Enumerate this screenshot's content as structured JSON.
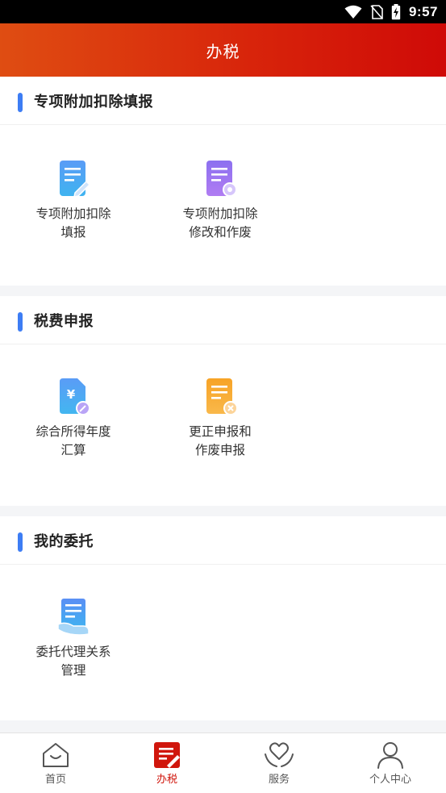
{
  "status_bar": {
    "time": "9:57"
  },
  "header": {
    "title": "办税"
  },
  "sections": [
    {
      "title": "专项附加扣除填报",
      "items": [
        {
          "line1": "专项附加扣除",
          "line2": "填报",
          "icon": "edit-document-icon"
        },
        {
          "line1": "专项附加扣除",
          "line2": "修改和作废",
          "icon": "document-settings-icon"
        }
      ]
    },
    {
      "title": "税费申报",
      "items": [
        {
          "line1": "综合所得年度",
          "line2": "汇算",
          "icon": "yuan-document-icon"
        },
        {
          "line1": "更正申报和",
          "line2": "作废申报",
          "icon": "document-cancel-icon"
        }
      ]
    },
    {
      "title": "我的委托",
      "items": [
        {
          "line1": "委托代理关系",
          "line2": "管理",
          "icon": "hand-document-icon"
        }
      ]
    }
  ],
  "tabbar": {
    "active": "tab-tax",
    "tabs": [
      {
        "label": "首页",
        "icon": "home-icon"
      },
      {
        "label": "办税",
        "icon": "tax-form-icon"
      },
      {
        "label": "服务",
        "icon": "heart-hands-icon"
      },
      {
        "label": "个人中心",
        "icon": "person-icon"
      }
    ]
  },
  "colors": {
    "header_start": "#df4d12",
    "header_end": "#cf0a07",
    "accent_blue": "#3d7df4",
    "active_tab": "#d0160c"
  }
}
